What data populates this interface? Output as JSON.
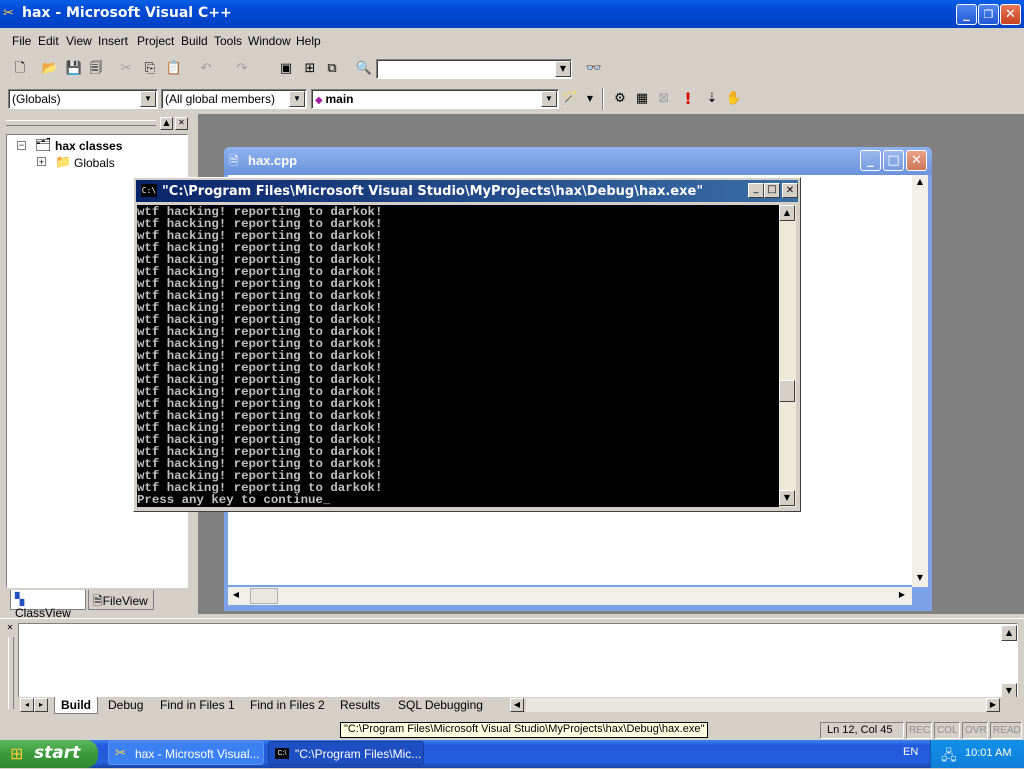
{
  "window": {
    "title": "hax - Microsoft Visual C++"
  },
  "menu": [
    "File",
    "Edit",
    "View",
    "Insert",
    "Project",
    "Build",
    "Tools",
    "Window",
    "Help"
  ],
  "toolbar": {
    "find_combo_value": ""
  },
  "wizardbar": {
    "scope": "(Globals)",
    "members": "(All global members)",
    "function": "main"
  },
  "workspace": {
    "root": "hax classes",
    "child": "Globals",
    "tabs": [
      "ClassView",
      "FileView"
    ]
  },
  "editor": {
    "title": "hax.cpp"
  },
  "console": {
    "title": "\"C:\\Program Files\\Microsoft Visual Studio\\MyProjects\\hax\\Debug\\hax.exe\"",
    "lines": [
      "wtf hacking! reporting to darkok!",
      "wtf hacking! reporting to darkok!",
      "wtf hacking! reporting to darkok!",
      "wtf hacking! reporting to darkok!",
      "wtf hacking! reporting to darkok!",
      "wtf hacking! reporting to darkok!",
      "wtf hacking! reporting to darkok!",
      "wtf hacking! reporting to darkok!",
      "wtf hacking! reporting to darkok!",
      "wtf hacking! reporting to darkok!",
      "wtf hacking! reporting to darkok!",
      "wtf hacking! reporting to darkok!",
      "wtf hacking! reporting to darkok!",
      "wtf hacking! reporting to darkok!",
      "wtf hacking! reporting to darkok!",
      "wtf hacking! reporting to darkok!",
      "wtf hacking! reporting to darkok!",
      "wtf hacking! reporting to darkok!",
      "wtf hacking! reporting to darkok!",
      "wtf hacking! reporting to darkok!",
      "wtf hacking! reporting to darkok!",
      "wtf hacking! reporting to darkok!",
      "wtf hacking! reporting to darkok!",
      "wtf hacking! reporting to darkok!",
      "Press any key to continue"
    ]
  },
  "output": {
    "tabs": [
      "Build",
      "Debug",
      "Find in Files 1",
      "Find in Files 2",
      "Results",
      "SQL Debugging"
    ]
  },
  "status": {
    "tooltip": "\"C:\\Program Files\\Microsoft Visual Studio\\MyProjects\\hax\\Debug\\hax.exe\"",
    "position": "Ln 12, Col 45",
    "indicators": [
      "REC",
      "COL",
      "OVR",
      "READ"
    ]
  },
  "taskbar": {
    "start": "start",
    "tasks": [
      "hax - Microsoft Visual...",
      "\"C:\\Program Files\\Mic..."
    ],
    "lang": "EN",
    "clock": "10:01 AM"
  },
  "colors": {
    "xp_blue": "#0048d4",
    "console_bg": "#000000",
    "console_text": "#c0c0c0",
    "start_green": "#3c9a3c"
  }
}
